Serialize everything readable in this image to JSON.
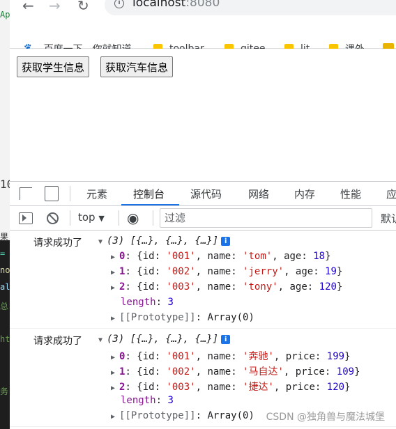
{
  "browser": {
    "url_host": "localhost",
    "url_port": ":8080",
    "bookmarks": [
      {
        "label": "百度一下，你就知道",
        "icon": "baidu-paw-icon"
      },
      {
        "label": "toolbar",
        "icon": "folder-icon"
      },
      {
        "label": "gitee",
        "icon": "folder-icon"
      },
      {
        "label": "lit",
        "icon": "folder-icon"
      },
      {
        "label": "课外",
        "icon": "folder-icon"
      }
    ]
  },
  "page": {
    "buttons": [
      "获取学生信息",
      "获取汽车信息"
    ]
  },
  "devtools": {
    "tabs": [
      "元素",
      "控制台",
      "源代码",
      "网络",
      "内存",
      "性能",
      "应"
    ],
    "active_tab": "控制台",
    "context": "top",
    "filter_placeholder": "过滤",
    "levels_label": "默认",
    "accent": "#1a73e8"
  },
  "console": {
    "messages": [
      {
        "prefix": "请求成功了",
        "summary": "(3) [{…}, {…}, {…}]",
        "items": [
          {
            "index": "0",
            "id": "'001'",
            "k2": "name",
            "v2": "'tom'",
            "k3": "age",
            "v3": "18"
          },
          {
            "index": "1",
            "id": "'002'",
            "k2": "name",
            "v2": "'jerry'",
            "k3": "age",
            "v3": "19"
          },
          {
            "index": "2",
            "id": "'003'",
            "k2": "name",
            "v2": "'tony'",
            "k3": "age",
            "v3": "120"
          }
        ],
        "length": "3",
        "prototype": "Array(0)"
      },
      {
        "prefix": "请求成功了",
        "summary": "(3) [{…}, {…}, {…}]",
        "items": [
          {
            "index": "0",
            "id": "'001'",
            "k2": "name",
            "v2": "'奔驰'",
            "k3": "price",
            "v3": "199"
          },
          {
            "index": "1",
            "id": "'002'",
            "k2": "name",
            "v2": "'马自达'",
            "k3": "price",
            "v3": "109"
          },
          {
            "index": "2",
            "id": "'003'",
            "k2": "name",
            "v2": "'捷达'",
            "k3": "price",
            "v3": "120"
          }
        ],
        "length": "3",
        "prototype": "Array(0)"
      }
    ]
  },
  "watermark": "CSDN @独角兽与魔法城堡",
  "editor_fragments": [
    "Ap",
    "10",
    "果",
    "=",
    "no",
    "al",
    "总",
    "ht",
    "务"
  ]
}
